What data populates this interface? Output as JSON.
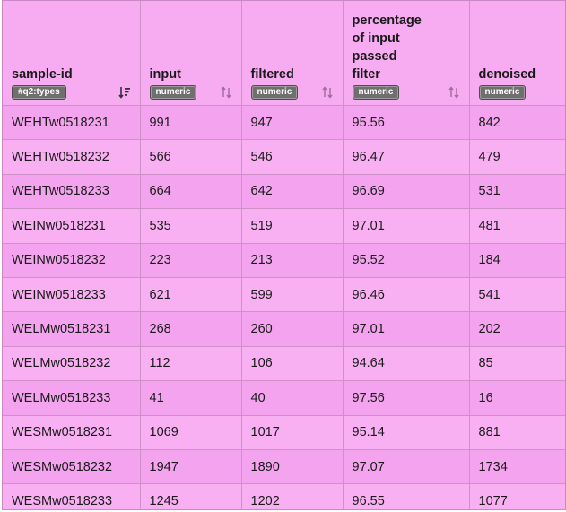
{
  "table": {
    "columns": [
      {
        "label": "sample-id",
        "badge": "#q2:types",
        "sort": "sort-active-icon"
      },
      {
        "label": "input",
        "badge": "numeric",
        "sort": "sort-icon"
      },
      {
        "label": "filtered",
        "badge": "numeric",
        "sort": "sort-icon"
      },
      {
        "label": "percentage of input passed filter",
        "badge": "numeric",
        "sort": "sort-icon"
      },
      {
        "label": "denoised",
        "badge": "numeric",
        "sort": "sort-icon"
      }
    ],
    "rows": [
      [
        "WEHTw0518231",
        "991",
        "947",
        "95.56",
        "842"
      ],
      [
        "WEHTw0518232",
        "566",
        "546",
        "96.47",
        "479"
      ],
      [
        "WEHTw0518233",
        "664",
        "642",
        "96.69",
        "531"
      ],
      [
        "WEINw0518231",
        "535",
        "519",
        "97.01",
        "481"
      ],
      [
        "WEINw0518232",
        "223",
        "213",
        "95.52",
        "184"
      ],
      [
        "WEINw0518233",
        "621",
        "599",
        "96.46",
        "541"
      ],
      [
        "WELMw0518231",
        "268",
        "260",
        "97.01",
        "202"
      ],
      [
        "WELMw0518232",
        "112",
        "106",
        "94.64",
        "85"
      ],
      [
        "WELMw0518233",
        "41",
        "40",
        "97.56",
        "16"
      ],
      [
        "WESMw0518231",
        "1069",
        "1017",
        "95.14",
        "881"
      ],
      [
        "WESMw0518232",
        "1947",
        "1890",
        "97.07",
        "1734"
      ],
      [
        "WESMw0518233",
        "1245",
        "1202",
        "96.55",
        "1077"
      ]
    ]
  },
  "colors": {
    "background": "#f6aaf0",
    "badge": "#6f6f6f",
    "grid": "#cf90c9"
  }
}
